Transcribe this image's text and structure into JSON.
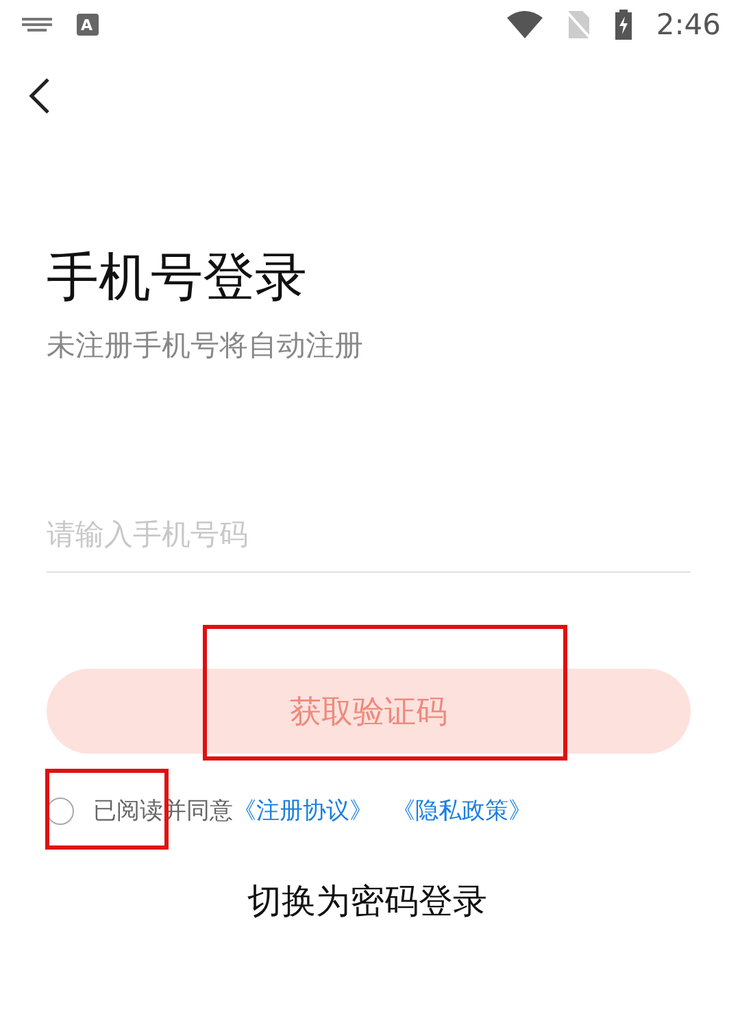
{
  "status_bar": {
    "ime_badge": "A",
    "time": "2:46"
  },
  "title": "手机号登录",
  "subtitle": "未注册手机号将自动注册",
  "phone_field": {
    "placeholder": "请输入手机号码"
  },
  "get_code_button": {
    "label": "获取验证码",
    "disabled": true
  },
  "agreement": {
    "checked": false,
    "text": "已阅读并同意",
    "links": [
      "《注册协议》",
      "《隐私政策》"
    ]
  },
  "switch_link": "切换为密码登录"
}
